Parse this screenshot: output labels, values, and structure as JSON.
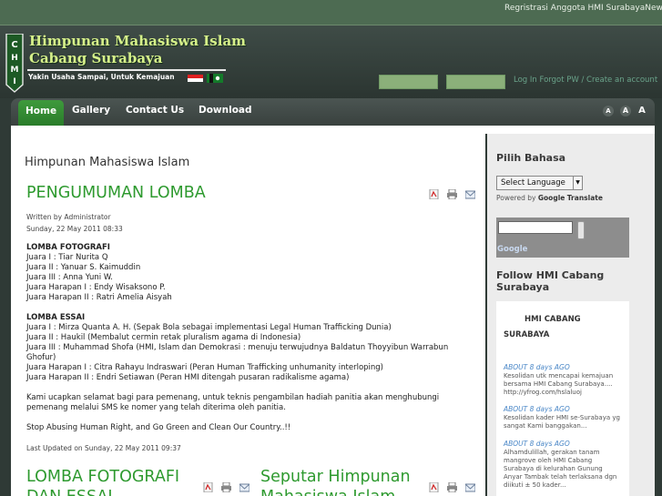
{
  "topbar": {
    "ticker": "Regristrasi Anggota HMI SurabayaNews eg"
  },
  "header": {
    "title_line1": "Himpunan Mahasiswa Islam",
    "title_line2": "Cabang Surabaya",
    "tagline": "Yakin Usaha Sampai, Untuk Kemajuan",
    "login_links": "Log In Forgot PW / Create an account"
  },
  "nav": {
    "items": [
      "Home",
      "Gallery",
      "Contact Us",
      "Download"
    ],
    "font_sizes": [
      "A",
      "A",
      "A"
    ]
  },
  "content": {
    "heading": "Himpunan Mahasiswa Islam",
    "article1": {
      "title": "PENGUMUMAN LOMBA",
      "author": "Written by Administrator",
      "date": "Sunday, 22 May 2011 08:33",
      "section1_title": "LOMBA FOTOGRAFI",
      "section1_lines": [
        "Juara I : Tiar Nurita Q",
        "Juara II : Yanuar S. Kaimuddin",
        "Juara III : Anna Yuni W.",
        "Juara Harapan I : Endy Wisaksono P.",
        "Juara Harapan II : Ratri Amelia Aisyah"
      ],
      "section2_title": "LOMBA ESSAI",
      "section2_lines": [
        "Juara I : Mirza Quanta A. H. (Sepak Bola sebagai implementasi Legal Human Trafficking Dunia)",
        "Juara II : Haukil (Membalut cermin retak pluralism agama di Indonesia)",
        "Juara III : Muhammad Shofa (HMI, Islam dan Demokrasi : menuju terwujudnya Baldatun Thoyyibun Warrabun Ghofur)",
        "Juara Harapan I : Citra Rahayu Indraswari (Peran Human Trafficking unhumanity interloping)",
        "Juara Harapan II : Endri Setiawan (Peran HMI ditengah pusaran radikalisme agama)"
      ],
      "paragraph1": "Kami ucapkan selamat bagi para pemenang, untuk teknis pengambilan hadiah panitia akan menghubungi pemenang melalui SMS ke nomer yang telah diterima oleh panitia.",
      "paragraph2": "Stop Abusing Human Right, and Go Green and Clean Our Country..!!",
      "updated": "Last Updated on Sunday, 22 May 2011 09:37"
    },
    "article2_title": "LOMBA FOTOGRAFI DAN ESSAI",
    "article3_title": "Seputar Himpunan Mahasiswa Islam"
  },
  "sidebar": {
    "lang_title": "Pilih Bahasa",
    "lang_select": "Select Language",
    "powered_by": "Powered by",
    "google": "Google",
    "translate": "Translate",
    "search_brand": "Google",
    "follow_title": "Follow HMI Cabang Surabaya",
    "twitter": {
      "name_line1": "HMI CABANG",
      "name_line2": "SURABAYA",
      "tweets": [
        {
          "when": "ABOUT 8 days AGO",
          "text": "Kesolidan utk mencapai kemajuan bersama HMI Cabang Surabaya.... http://yfrog.com/hslaluoj"
        },
        {
          "when": "ABOUT 8 days AGO",
          "text": "Kesolidan kader HMI se-Surabaya yg sangat Kami banggakan..."
        },
        {
          "when": "ABOUT 8 days AGO",
          "text": "Alhamdulillah, gerakan tanam mangrove oleh HMI Cabang Surabaya di kelurahan Gunung Anyar Tambak telah terlaksana dgn diikuti ± 50 kader..."
        }
      ]
    }
  },
  "colors": {
    "accent_green": "#2e9a2f",
    "nav_active": "#2a7c2a",
    "title_yellow": "#d6f08a",
    "link_blue": "#4a87c7"
  }
}
